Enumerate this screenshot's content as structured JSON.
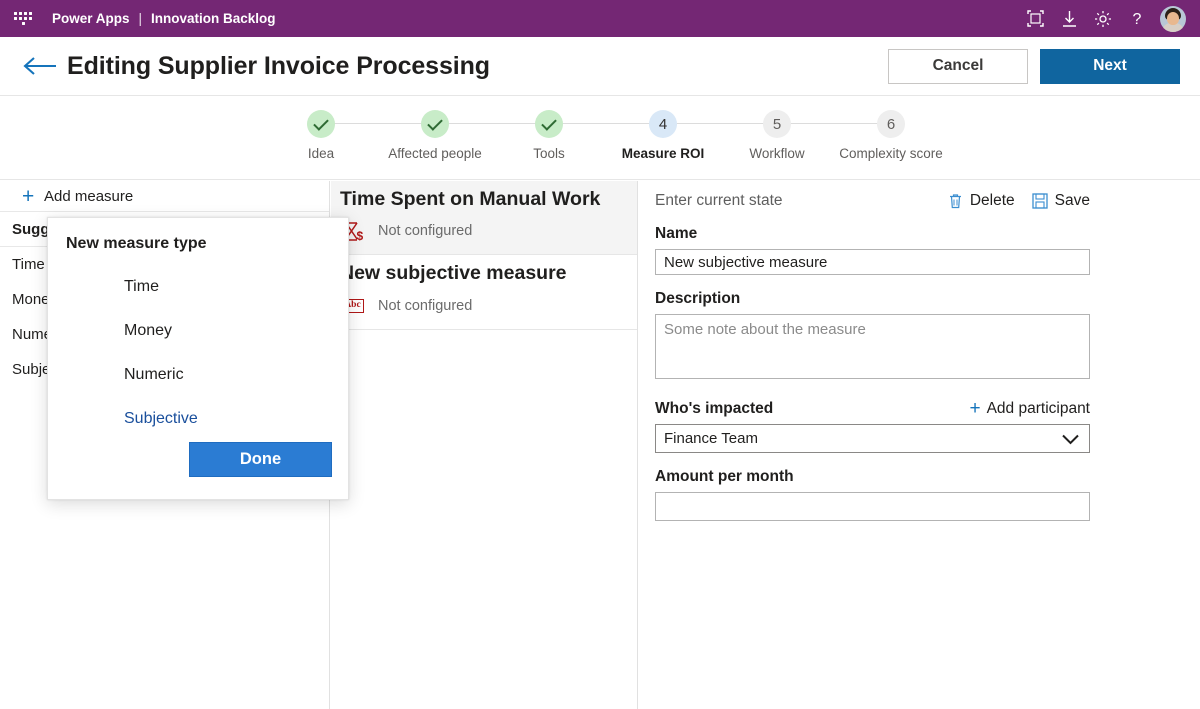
{
  "topbar": {
    "waffle_icon": "app-launcher-icon",
    "brand": "Power Apps",
    "separator": "|",
    "app_name": "Innovation Backlog",
    "icons": [
      {
        "name": "fit-to-screen-icon",
        "label": "Fit to screen"
      },
      {
        "name": "download-icon",
        "label": "Download"
      },
      {
        "name": "gear-icon",
        "label": "Settings"
      },
      {
        "name": "help-icon",
        "label": "?"
      }
    ],
    "avatar_label": "Account manager"
  },
  "header": {
    "back_icon": "back-arrow-icon",
    "title": "Editing Supplier Invoice Processing",
    "cancel_label": "Cancel",
    "next_label": "Next"
  },
  "stepper": {
    "steps": [
      {
        "number": "1",
        "label": "Idea",
        "state": "done"
      },
      {
        "number": "2",
        "label": "Affected people",
        "state": "done"
      },
      {
        "number": "3",
        "label": "Tools",
        "state": "done"
      },
      {
        "number": "4",
        "label": "Measure ROI",
        "state": "current"
      },
      {
        "number": "5",
        "label": "Workflow",
        "state": "todo"
      },
      {
        "number": "6",
        "label": "Complexity score",
        "state": "todo"
      }
    ]
  },
  "left_panel": {
    "add_measure_label": "Add measure",
    "add_icon": "plus-icon",
    "suggested_header": "Suggested",
    "items": [
      {
        "label": "Time"
      },
      {
        "label": "Money"
      },
      {
        "label": "Numeric"
      },
      {
        "label": "Subjective"
      }
    ]
  },
  "measure_list": {
    "cards": [
      {
        "title": "Time Spent on Manual Work",
        "status": "Not configured",
        "icon": "hourglass-money-icon",
        "selected": true
      },
      {
        "title": "New subjective measure",
        "status": "Not configured",
        "icon": "abc-icon",
        "selected": false
      }
    ]
  },
  "detail_panel": {
    "state_text": "Enter current state",
    "delete_label": "Delete",
    "delete_icon": "trash-icon",
    "save_label": "Save",
    "save_icon": "save-icon",
    "name_label": "Name",
    "name_value": "New subjective measure",
    "description_label": "Description",
    "description_value": "",
    "description_placeholder": "Some note about the measure",
    "impacted_label": "Who's impacted",
    "add_participant_label": "Add participant",
    "add_participant_icon": "plus-icon",
    "impacted_value": "Finance Team",
    "impacted_options": [
      "Finance Team"
    ],
    "dropdown_icon": "chevron-down-icon",
    "amount_label": "Amount per month",
    "amount_value": ""
  },
  "dialog": {
    "title": "New measure type",
    "options": [
      {
        "label": "Time",
        "active": false
      },
      {
        "label": "Money",
        "active": false
      },
      {
        "label": "Numeric",
        "active": false
      },
      {
        "label": "Subjective",
        "active": true
      }
    ],
    "done_label": "Done"
  },
  "colors": {
    "brand_purple": "#742774",
    "primary_blue": "#10659f",
    "accent_blue": "#2b7cd3",
    "link_blue": "#1574bb",
    "step_done_green": "#c8ecc8",
    "step_current_blue": "#d9e8f7",
    "step_todo_grey": "#eeeeee",
    "icon_red": "#b01818"
  }
}
